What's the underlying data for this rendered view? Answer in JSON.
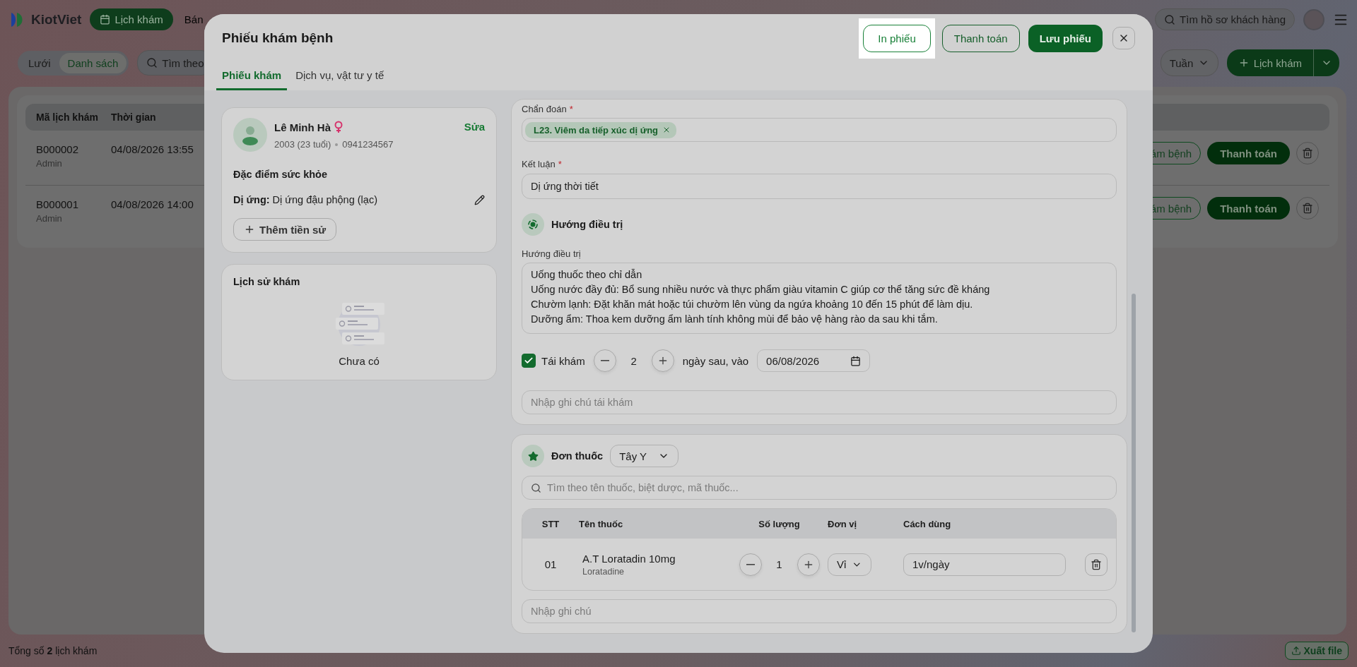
{
  "topbar": {
    "logo": "KiotViet",
    "nav": [
      {
        "label": "Lịch khám",
        "selected": true
      },
      {
        "label": "Bán",
        "selected": false
      }
    ],
    "search": {
      "placeholder": "Tìm hồ sơ khách hàng"
    }
  },
  "toolbar": {
    "views": [
      {
        "label": "Lưới",
        "selected": false
      },
      {
        "label": "Danh sách",
        "selected": true
      }
    ],
    "search": {
      "placeholder": "Tìm theo"
    },
    "period": "Tuần",
    "add_button": "Lịch khám"
  },
  "table": {
    "columns": [
      "Mã lịch khám",
      "Thời gian"
    ],
    "rows": [
      {
        "code": "B000002",
        "creator": "Admin",
        "time": "04/08/2026 13:55",
        "actions": [
          "ám bệnh",
          "Thanh toán"
        ]
      },
      {
        "code": "B000001",
        "creator": "Admin",
        "time": "04/08/2026 14:00",
        "actions": [
          "ám bệnh",
          "Thanh toán"
        ]
      }
    ]
  },
  "footer": {
    "total": "Tổng số **2** lịch khám",
    "export": "Xuất file"
  },
  "modal": {
    "title": "Phiếu khám bệnh",
    "actions": [
      {
        "label": "In phiếu",
        "kind": "highlighted"
      },
      {
        "label": "Thanh toán",
        "kind": "outline"
      },
      {
        "label": "Lưu phiếu",
        "kind": "primary"
      }
    ],
    "tabs": [
      {
        "label": "Phiếu khám",
        "selected": true
      },
      {
        "label": "Dịch vụ, vật tư y tế",
        "selected": false
      }
    ],
    "patient": {
      "name": "Lê Minh Hà",
      "birth": "2003 (23 tuổi)",
      "phone": "0941234567",
      "edit": "Sửa"
    },
    "health": {
      "title": "Đặc điểm sức khỏe",
      "items": [
        {
          "label": "Dị ứng:",
          "value": "Dị ứng đậu phộng (lạc)"
        }
      ],
      "add_button": "Thêm tiền sử"
    },
    "history": {
      "title": "Lịch sử khám",
      "empty": "Chưa có"
    },
    "exam": {
      "diagnosis": {
        "label": "Chẩn đoán",
        "mark": "*",
        "tags": [
          "L23. Viêm da tiếp xúc dị ứng"
        ]
      },
      "conclusion": {
        "label": "Kết luận",
        "mark": "*",
        "value": "Dị ứng thời tiết"
      },
      "treatment": {
        "section": "Hướng điều trị",
        "label": "Hướng điều trị",
        "lines": [
          "Uống thuốc theo chỉ dẫn",
          "Uống nước đầy đủ: Bổ sung nhiều nước và thực phẩm giàu vitamin C giúp cơ thể tăng sức đề kháng",
          "Chườm lạnh: Đặt khăn mát hoặc túi chườm lên vùng da ngứa khoảng 10 đến 15 phút để làm dịu.",
          "Dưỡng ẩm: Thoa kem dưỡng ẩm lành tính không mùi để bảo vệ hàng rào da sau khi tắm."
        ]
      },
      "follow_up": {
        "checked": true,
        "label": "Tái khám",
        "days": "2",
        "after": "ngày sau, vào",
        "date": "06/08/2026"
      },
      "note": {
        "placeholder": "Nhập ghi chú tái khám"
      }
    },
    "prescription": {
      "title": "Đơn thuốc",
      "type": "Tây Y",
      "search": {
        "placeholder": "Tìm theo tên thuốc, biệt dược, mã thuốc..."
      },
      "columns": [
        "STT",
        "Tên thuốc",
        "Số lượng",
        "Đơn vị",
        "Cách dùng"
      ],
      "rows": [
        {
          "index": "01",
          "name": "A.T Loratadin 10mg",
          "generic": "Loratadine",
          "quantity": "1",
          "unit": "Vỉ",
          "usage": "1v/ngày"
        }
      ],
      "note": {
        "placeholder": "Nhập ghi chú"
      }
    }
  }
}
